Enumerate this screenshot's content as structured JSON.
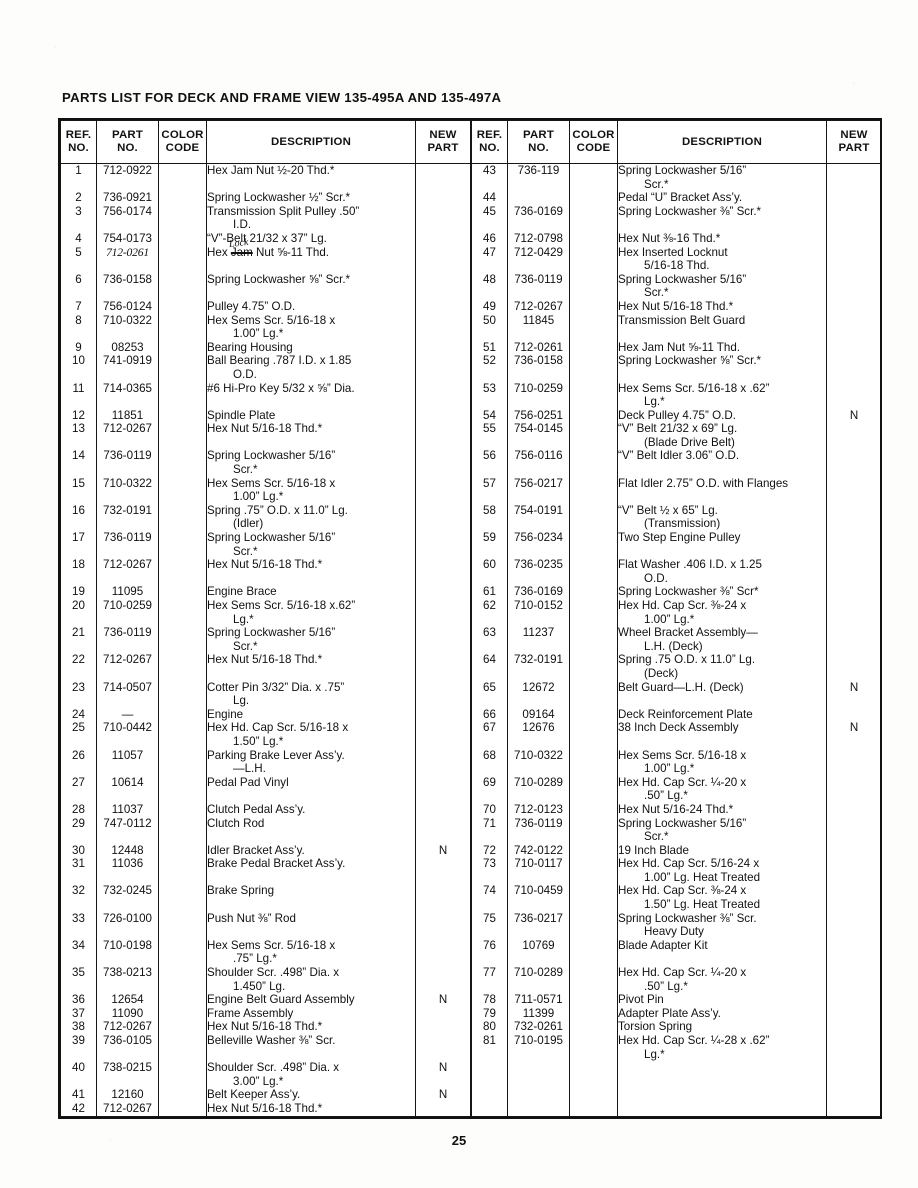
{
  "document": {
    "title": "PARTS LIST FOR DECK AND FRAME VIEW 135-495A AND 135-497A",
    "page_number": "25"
  },
  "table": {
    "headers": {
      "ref_no_line1": "REF.",
      "ref_no_line2": "NO.",
      "part_no_line1": "PART",
      "part_no_line2": "NO.",
      "color_code_line1": "COLOR",
      "color_code_line2": "CODE",
      "description": "DESCRIPTION",
      "new_part_line1": "NEW",
      "new_part_line2": "PART"
    },
    "left_rows": [
      {
        "ref": "1",
        "part": "712-0922",
        "color": "",
        "desc": "Hex Jam Nut ½-20 Thd.*",
        "desc2": "",
        "new": ""
      },
      {
        "ref": "2",
        "part": "736-0921",
        "color": "",
        "desc": "Spring Lockwasher ½” Scr.*",
        "desc2": "",
        "new": ""
      },
      {
        "ref": "3",
        "part": "756-0174",
        "color": "",
        "desc": "Transmission Split Pulley .50”",
        "desc2": "I.D.",
        "new": ""
      },
      {
        "ref": "4",
        "part": "754-0173",
        "color": "",
        "desc": "“V”-Belt 21/32 x 37” Lg.",
        "desc2": "",
        "new": ""
      },
      {
        "ref": "5",
        "part": "712-0261",
        "color": "",
        "desc": "Hex Jam Nut ⅝-11 Thd.",
        "desc2": "",
        "new": "",
        "annotated": true,
        "annotation": "Lock"
      },
      {
        "ref": "6",
        "part": "736-0158",
        "color": "",
        "desc": "Spring Lockwasher ⅝” Scr.*",
        "desc2": "",
        "new": ""
      },
      {
        "ref": "7",
        "part": "756-0124",
        "color": "",
        "desc": "Pulley 4.75” O.D.",
        "desc2": "",
        "new": ""
      },
      {
        "ref": "8",
        "part": "710-0322",
        "color": "",
        "desc": "Hex Sems Scr. 5/16-18 x",
        "desc2": "1.00” Lg.*",
        "new": ""
      },
      {
        "ref": "9",
        "part": "08253",
        "color": "",
        "desc": "Bearing Housing",
        "desc2": "",
        "new": ""
      },
      {
        "ref": "10",
        "part": "741-0919",
        "color": "",
        "desc": "Ball Bearing .787 I.D. x  1.85",
        "desc2": "O.D.",
        "new": ""
      },
      {
        "ref": "11",
        "part": "714-0365",
        "color": "",
        "desc": "#6 Hi-Pro Key 5/32 x ⅝” Dia.",
        "desc2": "",
        "new": ""
      },
      {
        "ref": "12",
        "part": "11851",
        "color": "",
        "desc": "Spindle Plate",
        "desc2": "",
        "new": ""
      },
      {
        "ref": "13",
        "part": "712-0267",
        "color": "",
        "desc": "Hex Nut 5/16-18 Thd.*",
        "desc2": "",
        "new": ""
      },
      {
        "ref": "14",
        "part": "736-0119",
        "color": "",
        "desc": "Spring Lockwasher 5/16”",
        "desc2": "Scr.*",
        "new": ""
      },
      {
        "ref": "15",
        "part": "710-0322",
        "color": "",
        "desc": "Hex Sems Scr. 5/16-18 x",
        "desc2": "1.00” Lg.*",
        "new": ""
      },
      {
        "ref": "16",
        "part": "732-0191",
        "color": "",
        "desc": "Spring .75” O.D. x 11.0” Lg.",
        "desc2": "(Idler)",
        "new": ""
      },
      {
        "ref": "17",
        "part": "736-0119",
        "color": "",
        "desc": "Spring Lockwasher 5/16”",
        "desc2": "Scr.*",
        "new": ""
      },
      {
        "ref": "18",
        "part": "712-0267",
        "color": "",
        "desc": "Hex Nut 5/16-18 Thd.*",
        "desc2": "",
        "new": ""
      },
      {
        "ref": "19",
        "part": "11095",
        "color": "",
        "desc": "Engine Brace",
        "desc2": "",
        "new": ""
      },
      {
        "ref": "20",
        "part": "710-0259",
        "color": "",
        "desc": "Hex Sems Scr. 5/16-18 x.62”",
        "desc2": "Lg.*",
        "new": ""
      },
      {
        "ref": "21",
        "part": "736-0119",
        "color": "",
        "desc": "Spring Lockwasher 5/16”",
        "desc2": "Scr.*",
        "new": ""
      },
      {
        "ref": "22",
        "part": "712-0267",
        "color": "",
        "desc": "Hex Nut 5/16-18 Thd.*",
        "desc2": "",
        "new": ""
      },
      {
        "ref": "23",
        "part": "714-0507",
        "color": "",
        "desc": "Cotter Pin 3/32” Dia. x .75”",
        "desc2": "Lg.",
        "new": ""
      },
      {
        "ref": "24",
        "part": "—",
        "color": "",
        "desc": "Engine",
        "desc2": "",
        "new": ""
      },
      {
        "ref": "25",
        "part": "710-0442",
        "color": "",
        "desc": "Hex Hd. Cap Scr. 5/16-18 x",
        "desc2": "1.50” Lg.*",
        "new": ""
      },
      {
        "ref": "26",
        "part": "11057",
        "color": "",
        "desc": "Parking Brake Lever Ass’y.",
        "desc2": "—L.H.",
        "new": ""
      },
      {
        "ref": "27",
        "part": "10614",
        "color": "",
        "desc": "Pedal Pad Vinyl",
        "desc2": "",
        "new": ""
      },
      {
        "ref": "28",
        "part": "11037",
        "color": "",
        "desc": "Clutch Pedal Ass’y.",
        "desc2": "",
        "new": ""
      },
      {
        "ref": "29",
        "part": "747-0112",
        "color": "",
        "desc": "Clutch Rod",
        "desc2": "",
        "new": ""
      },
      {
        "ref": "30",
        "part": "12448",
        "color": "",
        "desc": "Idler Bracket Ass’y.",
        "desc2": "",
        "new": "N"
      },
      {
        "ref": "31",
        "part": "11036",
        "color": "",
        "desc": "Brake Pedal Bracket Ass’y.",
        "desc2": "",
        "new": ""
      },
      {
        "ref": "32",
        "part": "732-0245",
        "color": "",
        "desc": "Brake Spring",
        "desc2": "",
        "new": ""
      },
      {
        "ref": "33",
        "part": "726-0100",
        "color": "",
        "desc": "Push Nut ⅜” Rod",
        "desc2": "",
        "new": ""
      },
      {
        "ref": "34",
        "part": "710-0198",
        "color": "",
        "desc": "Hex Sems Scr. 5/16-18 x",
        "desc2": ".75” Lg.*",
        "new": ""
      },
      {
        "ref": "35",
        "part": "738-0213",
        "color": "",
        "desc": "Shoulder Scr. .498” Dia. x",
        "desc2": "1.450” Lg.",
        "new": ""
      },
      {
        "ref": "36",
        "part": "12654",
        "color": "",
        "desc": "Engine Belt Guard Assembly",
        "desc2": "",
        "new": "N"
      },
      {
        "ref": "37",
        "part": "11090",
        "color": "",
        "desc": "Frame Assembly",
        "desc2": "",
        "new": ""
      },
      {
        "ref": "38",
        "part": "712-0267",
        "color": "",
        "desc": "Hex Nut 5/16-18 Thd.*",
        "desc2": "",
        "new": ""
      },
      {
        "ref": "39",
        "part": "736-0105",
        "color": "",
        "desc": "Belleville Washer ⅜” Scr.",
        "desc2": "",
        "new": ""
      },
      {
        "ref": "40",
        "part": "738-0215",
        "color": "",
        "desc": "Shoulder Scr. .498” Dia. x",
        "desc2": "3.00” Lg.*",
        "new": "N"
      },
      {
        "ref": "41",
        "part": "12160",
        "color": "",
        "desc": "Belt Keeper Ass’y.",
        "desc2": "",
        "new": "N"
      },
      {
        "ref": "42",
        "part": "712-0267",
        "color": "",
        "desc": "Hex Nut 5/16-18 Thd.*",
        "desc2": "",
        "new": ""
      }
    ],
    "right_rows": [
      {
        "ref": "43",
        "part": "736-119",
        "color": "",
        "desc": "Spring Lockwasher 5/16”",
        "desc2": "Scr.*",
        "new": ""
      },
      {
        "ref": "44",
        "part": "",
        "color": "",
        "desc": "Pedal “U” Bracket Ass’y.",
        "desc2": "",
        "new": ""
      },
      {
        "ref": "45",
        "part": "736-0169",
        "color": "",
        "desc": "Spring Lockwasher ⅜” Scr.*",
        "desc2": "",
        "new": ""
      },
      {
        "ref": "46",
        "part": "712-0798",
        "color": "",
        "desc": "Hex Nut ⅜-16 Thd.*",
        "desc2": "",
        "new": ""
      },
      {
        "ref": "47",
        "part": "712-0429",
        "color": "",
        "desc": "Hex Inserted Locknut",
        "desc2": "5/16-18 Thd.",
        "new": ""
      },
      {
        "ref": "48",
        "part": "736-0119",
        "color": "",
        "desc": "Spring Lockwasher 5/16”",
        "desc2": "Scr.*",
        "new": ""
      },
      {
        "ref": "49",
        "part": "712-0267",
        "color": "",
        "desc": "Hex Nut 5/16-18 Thd.*",
        "desc2": "",
        "new": ""
      },
      {
        "ref": "50",
        "part": "11845",
        "color": "",
        "desc": "Transmission Belt Guard",
        "desc2": "",
        "new": ""
      },
      {
        "ref": "51",
        "part": "712-0261",
        "color": "",
        "desc": "Hex Jam Nut ⅝-11 Thd.",
        "desc2": "",
        "new": ""
      },
      {
        "ref": "52",
        "part": "736-0158",
        "color": "",
        "desc": "Spring Lockwasher ⅝” Scr.*",
        "desc2": "",
        "new": ""
      },
      {
        "ref": "53",
        "part": "710-0259",
        "color": "",
        "desc": "Hex Sems Scr. 5/16-18 x .62”",
        "desc2": "Lg.*",
        "new": ""
      },
      {
        "ref": "54",
        "part": "756-0251",
        "color": "",
        "desc": "Deck Pulley 4.75” O.D.",
        "desc2": "",
        "new": "N"
      },
      {
        "ref": "55",
        "part": "754-0145",
        "color": "",
        "desc": "“V” Belt 21/32 x 69” Lg.",
        "desc2": "(Blade Drive Belt)",
        "new": ""
      },
      {
        "ref": "56",
        "part": "756-0116",
        "color": "",
        "desc": "“V” Belt Idler 3.06” O.D.",
        "desc2": "",
        "new": ""
      },
      {
        "ref": "57",
        "part": "756-0217",
        "color": "",
        "desc": "Flat Idler 2.75” O.D. with Flanges",
        "desc2": "",
        "new": ""
      },
      {
        "ref": "58",
        "part": "754-0191",
        "color": "",
        "desc": "“V” Belt ½ x 65” Lg.",
        "desc2": "(Transmission)",
        "new": ""
      },
      {
        "ref": "59",
        "part": "756-0234",
        "color": "",
        "desc": "Two Step Engine Pulley",
        "desc2": "",
        "new": ""
      },
      {
        "ref": "60",
        "part": "736-0235",
        "color": "",
        "desc": "Flat Washer .406 I.D. x 1.25",
        "desc2": "O.D.",
        "new": ""
      },
      {
        "ref": "61",
        "part": "736-0169",
        "color": "",
        "desc": "Spring Lockwasher ⅜” Scr*",
        "desc2": "",
        "new": ""
      },
      {
        "ref": "62",
        "part": "710-0152",
        "color": "",
        "desc": "Hex Hd. Cap Scr. ⅜-24 x",
        "desc2": "1.00” Lg.*",
        "new": ""
      },
      {
        "ref": "63",
        "part": "11237",
        "color": "",
        "desc": "Wheel Bracket Assembly—",
        "desc2": "L.H. (Deck)",
        "new": ""
      },
      {
        "ref": "64",
        "part": "732-0191",
        "color": "",
        "desc": "Spring .75 O.D. x 11.0” Lg.",
        "desc2": "(Deck)",
        "new": ""
      },
      {
        "ref": "65",
        "part": "12672",
        "color": "",
        "desc": "Belt Guard—L.H. (Deck)",
        "desc2": "",
        "new": "N"
      },
      {
        "ref": "66",
        "part": "09164",
        "color": "",
        "desc": "Deck Reinforcement Plate",
        "desc2": "",
        "new": ""
      },
      {
        "ref": "67",
        "part": "12676",
        "color": "",
        "desc": "38 Inch Deck Assembly",
        "desc2": "",
        "new": "N"
      },
      {
        "ref": "68",
        "part": "710-0322",
        "color": "",
        "desc": "Hex Sems Scr. 5/16-18 x",
        "desc2": "1.00” Lg.*",
        "new": ""
      },
      {
        "ref": "69",
        "part": "710-0289",
        "color": "",
        "desc": "Hex Hd. Cap Scr. ¼-20 x",
        "desc2": ".50” Lg.*",
        "new": ""
      },
      {
        "ref": "70",
        "part": "712-0123",
        "color": "",
        "desc": "Hex Nut 5/16-24 Thd.*",
        "desc2": "",
        "new": ""
      },
      {
        "ref": "71",
        "part": "736-0119",
        "color": "",
        "desc": "Spring Lockwasher 5/16”",
        "desc2": "Scr.*",
        "new": ""
      },
      {
        "ref": "72",
        "part": "742-0122",
        "color": "",
        "desc": "19 Inch Blade",
        "desc2": "",
        "new": ""
      },
      {
        "ref": "73",
        "part": "710-0117",
        "color": "",
        "desc": "Hex Hd. Cap Scr. 5/16-24 x",
        "desc2": "1.00” Lg. Heat Treated",
        "new": ""
      },
      {
        "ref": "74",
        "part": "710-0459",
        "color": "",
        "desc": "Hex Hd. Cap Scr. ⅜-24 x",
        "desc2": "1.50” Lg. Heat Treated",
        "new": ""
      },
      {
        "ref": "75",
        "part": "736-0217",
        "color": "",
        "desc": "Spring Lockwasher ⅜” Scr.",
        "desc2": "Heavy Duty",
        "new": ""
      },
      {
        "ref": "76",
        "part": "10769",
        "color": "",
        "desc": "Blade Adapter Kit",
        "desc2": "",
        "new": ""
      },
      {
        "ref": "77",
        "part": "710-0289",
        "color": "",
        "desc": "Hex Hd. Cap Scr. ¼-20 x",
        "desc2": ".50” Lg.*",
        "new": ""
      },
      {
        "ref": "78",
        "part": "711-0571",
        "color": "",
        "desc": "Pivot Pin",
        "desc2": "",
        "new": ""
      },
      {
        "ref": "79",
        "part": "11399",
        "color": "",
        "desc": "Adapter Plate Ass’y.",
        "desc2": "",
        "new": ""
      },
      {
        "ref": "80",
        "part": "732-0261",
        "color": "",
        "desc": "Torsion Spring",
        "desc2": "",
        "new": ""
      },
      {
        "ref": "81",
        "part": "710-0195",
        "color": "",
        "desc": "Hex Hd. Cap Scr. ¼-28 x .62”",
        "desc2": "Lg.*",
        "new": ""
      }
    ]
  }
}
